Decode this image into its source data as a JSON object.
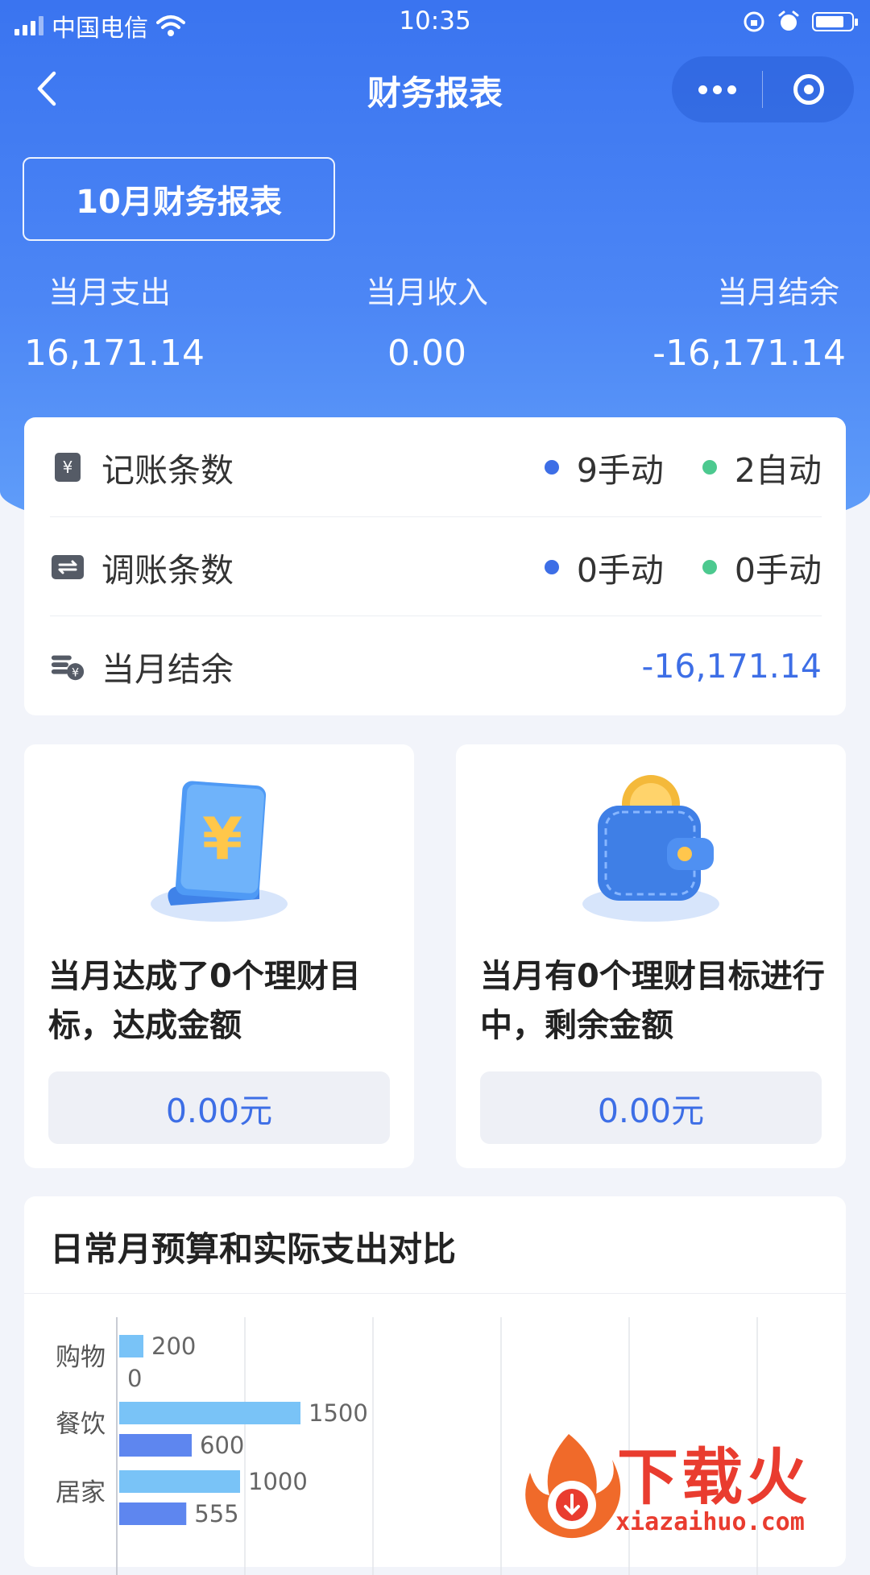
{
  "status_bar": {
    "carrier": "中国电信",
    "time": "10:35"
  },
  "nav": {
    "title": "财务报表"
  },
  "month_button": "10月财务报表",
  "summary": [
    {
      "label": "当月支出",
      "value": "16,171.14"
    },
    {
      "label": "当月收入",
      "value": "0.00"
    },
    {
      "label": "当月结余",
      "value": "-16,171.14"
    }
  ],
  "stats": {
    "entries": {
      "label": "记账条数",
      "tag1": "9手动",
      "tag2": "2自动"
    },
    "adjust": {
      "label": "调账条数",
      "tag1": "0手动",
      "tag2": "0手动"
    },
    "balance": {
      "label": "当月结余",
      "value": "-16,171.14"
    }
  },
  "colors": {
    "accent": "#3d6ee6",
    "dot_blue": "#3d6ee6",
    "dot_green": "#4cc98f",
    "budget_bar": "#79c3f7",
    "actual_bar": "#5e86ef"
  },
  "goals": [
    {
      "text": "当月达成了0个理财目标，达成金额",
      "value": "0.00元",
      "icon": "yuan-document-icon"
    },
    {
      "text": "当月有0个理财目标进行中，剩余金额",
      "value": "0.00元",
      "icon": "wallet-coin-icon"
    }
  ],
  "chart_section": {
    "title": "日常月预算和实际支出对比"
  },
  "chart_data": {
    "type": "bar",
    "orientation": "horizontal",
    "categories": [
      "购物",
      "餐饮",
      "居家"
    ],
    "series": [
      {
        "values": [
          200,
          1500,
          1000
        ]
      },
      {
        "values": [
          0,
          600,
          555
        ]
      }
    ],
    "grid": true
  },
  "watermark": {
    "text": "下载火",
    "url": "xiazaihuo.com"
  }
}
